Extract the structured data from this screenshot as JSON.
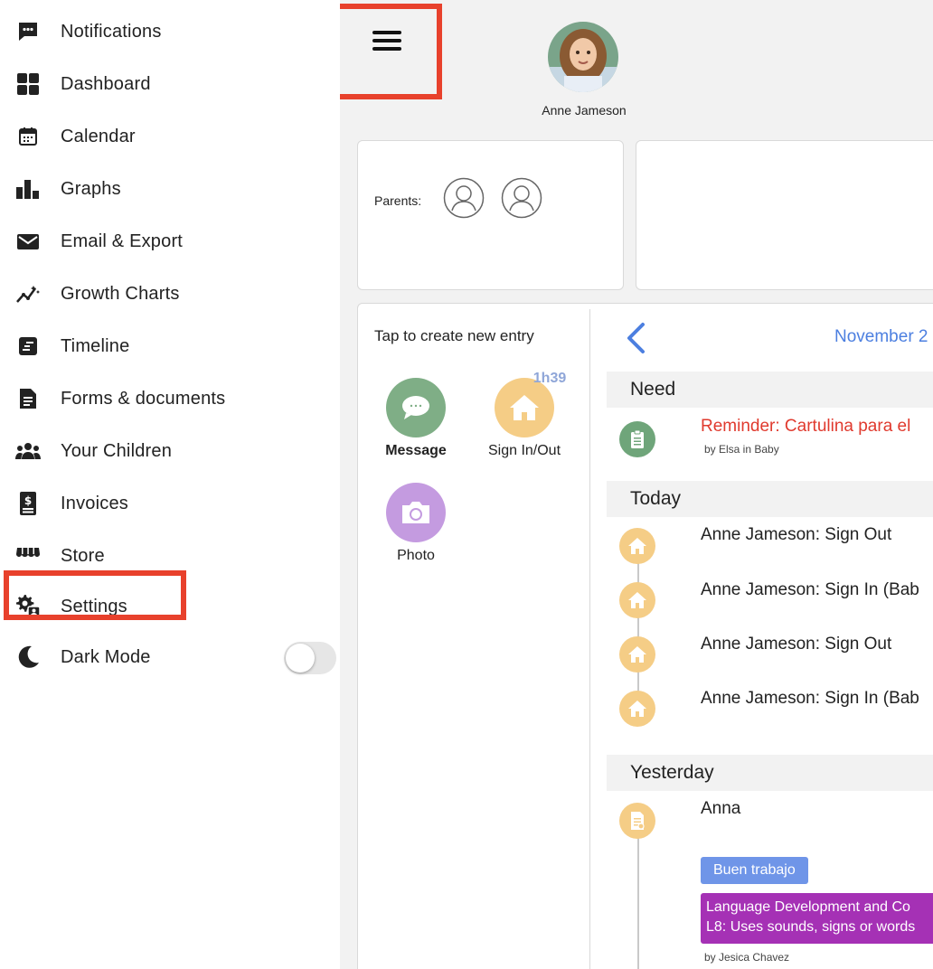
{
  "sidebar": {
    "items": [
      {
        "label": "Notifications",
        "icon": "chat-bubble-icon"
      },
      {
        "label": "Dashboard",
        "icon": "grid-icon"
      },
      {
        "label": "Calendar",
        "icon": "calendar-icon"
      },
      {
        "label": "Graphs",
        "icon": "bar-chart-icon"
      },
      {
        "label": "Email & Export",
        "icon": "envelope-icon"
      },
      {
        "label": "Growth Charts",
        "icon": "growth-line-icon"
      },
      {
        "label": "Timeline",
        "icon": "timeline-icon"
      },
      {
        "label": "Forms & documents",
        "icon": "document-icon"
      },
      {
        "label": "Your Children",
        "icon": "people-icon"
      },
      {
        "label": "Invoices",
        "icon": "invoice-icon"
      },
      {
        "label": "Store",
        "icon": "store-icon"
      },
      {
        "label": "Settings",
        "icon": "settings-gear-icon"
      },
      {
        "label": "Dark Mode",
        "icon": "moon-icon"
      }
    ],
    "dark_mode": false
  },
  "header": {
    "child_name": "Anne Jameson"
  },
  "parents": {
    "label": "Parents:"
  },
  "entries": {
    "title": "Tap to create new entry",
    "message_label": "Message",
    "sign_label": "Sign In/Out",
    "timer": "1h39",
    "photo_label": "Photo"
  },
  "feed": {
    "date": "November 2",
    "sections": {
      "need": "Need",
      "today": "Today",
      "yesterday": "Yesterday"
    },
    "need_item": {
      "title": "Reminder: Cartulina para el",
      "by": "by Elsa in Baby"
    },
    "today_items": [
      "Anne Jameson: Sign Out",
      "Anne Jameson: Sign In (Bab",
      "Anne Jameson: Sign Out",
      "Anne Jameson: Sign In (Bab"
    ],
    "yesterday_item": {
      "title": "Anna",
      "tag": "Buen trabajo",
      "milestone_line1": "Language Development and Co",
      "milestone_line2": "L8: Uses sounds, signs or words",
      "by": "by Jesica Chavez"
    }
  },
  "colors": {
    "highlight": "#e8412c",
    "accent_blue": "#4c7fe0",
    "reminder_red": "#e03a2e",
    "message_green": "#7fae86",
    "sign_orange": "#f5cd86",
    "photo_purple": "#c49be0",
    "tag_blue": "#6f95e8",
    "tag_purple": "#a531b5"
  }
}
